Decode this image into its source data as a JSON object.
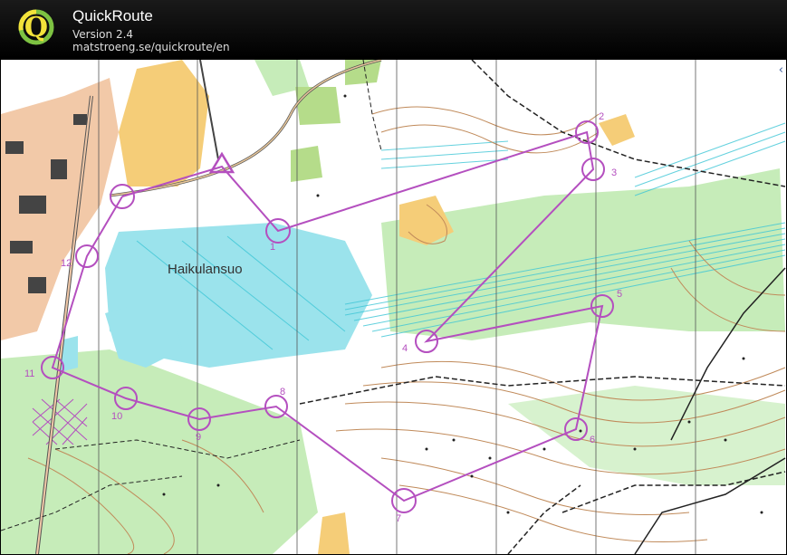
{
  "app": {
    "title": "QuickRoute",
    "version": "Version 2.4",
    "url": "matstroeng.se/quickroute/en",
    "logo_letter": "Q"
  },
  "map": {
    "lake_label": "Haikulansuo",
    "colors": {
      "course": "#b44fbf",
      "water": "#9be3ec",
      "marsh": "#3ec6d6",
      "green": "#c6ecb9",
      "open": "#f5cd78",
      "contour": "#c08a5a",
      "black": "#222222"
    },
    "controls": [
      {
        "label": "1"
      },
      {
        "label": "2"
      },
      {
        "label": "3"
      },
      {
        "label": "4"
      },
      {
        "label": "5"
      },
      {
        "label": "6"
      },
      {
        "label": "7"
      },
      {
        "label": "8"
      },
      {
        "label": "9"
      },
      {
        "label": "10"
      },
      {
        "label": "11"
      },
      {
        "label": "12"
      }
    ]
  },
  "collapse_icon": "chevron-left-icon",
  "collapse_glyph": "‹"
}
